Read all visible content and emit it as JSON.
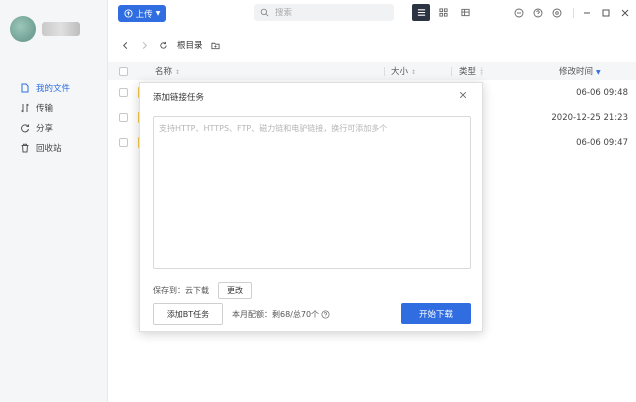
{
  "sidebar": {
    "items": [
      {
        "label": "我的文件",
        "icon": "file-icon",
        "active": true
      },
      {
        "label": "传输",
        "icon": "transfer-icon",
        "active": false
      },
      {
        "label": "分享",
        "icon": "share-icon",
        "active": false
      },
      {
        "label": "回收站",
        "icon": "trash-icon",
        "active": false
      }
    ]
  },
  "toolbar": {
    "upload_label": "上传",
    "search_placeholder": "搜索"
  },
  "breadcrumb": {
    "root": "根目录"
  },
  "table": {
    "columns": {
      "name": "名称",
      "size": "大小",
      "type": "类型",
      "modified": "修改时间"
    },
    "rows": [
      {
        "modified": "06-06 09:48"
      },
      {
        "modified": "2020-12-25 21:23"
      },
      {
        "modified": "06-06 09:47"
      }
    ]
  },
  "dialog": {
    "title": "添加链接任务",
    "textarea_placeholder": "支持HTTP、HTTPS、FTP、磁力链和电驴链接，换行可添加多个",
    "save_to_label": "保存到：云下载",
    "change_label": "更改",
    "bt_task_label": "添加BT任务",
    "quota_text": "本月配额：剩68/总70个",
    "start_label": "开始下载"
  },
  "colors": {
    "accent": "#2f6de1",
    "folder": "#f7c948",
    "view_active": "#2c3342"
  }
}
